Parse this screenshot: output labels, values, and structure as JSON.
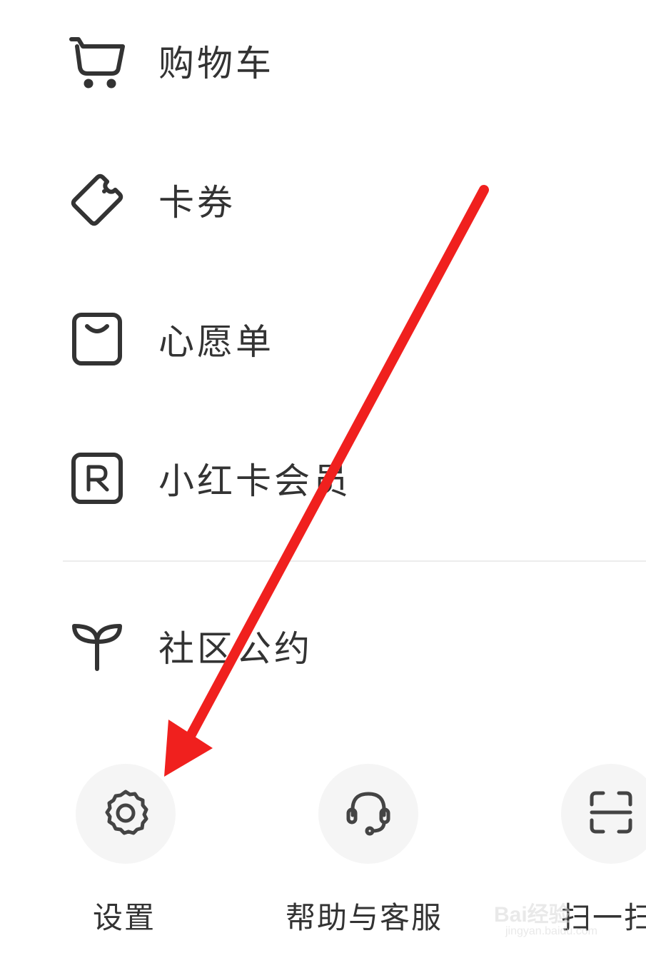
{
  "menu": {
    "items": [
      {
        "label": "购物车",
        "icon": "shopping-cart-icon"
      },
      {
        "label": "卡券",
        "icon": "coupon-ticket-icon"
      },
      {
        "label": "心愿单",
        "icon": "wishlist-bag-icon"
      },
      {
        "label": "小红卡会员",
        "icon": "membership-r-icon"
      },
      {
        "label": "社区公约",
        "icon": "sprout-icon"
      }
    ]
  },
  "bottom_actions": [
    {
      "label": "设置",
      "icon": "gear-icon"
    },
    {
      "label": "帮助与客服",
      "icon": "headset-icon"
    },
    {
      "label": "扫一扫",
      "icon": "scan-icon"
    }
  ],
  "annotation": {
    "arrow_color": "#f0201e"
  },
  "watermark": {
    "text": "Bai经验",
    "sub": "jingyan.baidu.com"
  }
}
